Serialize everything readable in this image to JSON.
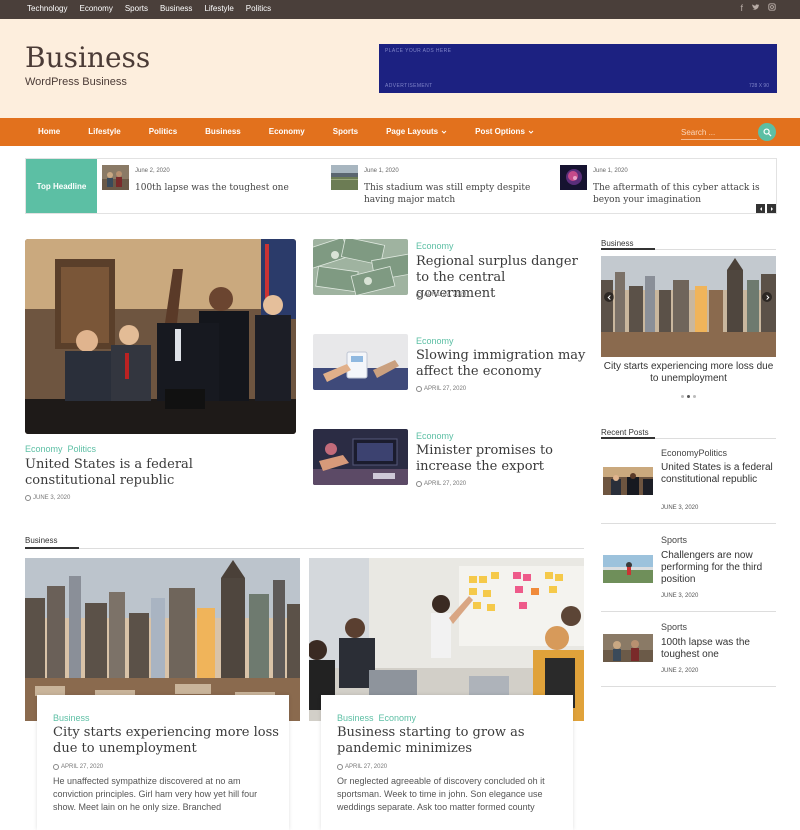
{
  "topbar": {
    "links": [
      "Technology",
      "Economy",
      "Sports",
      "Business",
      "Lifestyle",
      "Politics"
    ],
    "social_icons": [
      "facebook-icon",
      "twitter-icon",
      "instagram-icon"
    ]
  },
  "header": {
    "site_title": "Business",
    "tagline": "WordPress Business",
    "ad_top": "PLACE YOUR ADS HERE",
    "ad_bottom": "ADVERTISEMENT",
    "ad_size": "728 X 90"
  },
  "nav": {
    "items": [
      "Home",
      "Lifestyle",
      "Politics",
      "Business",
      "Economy",
      "Sports",
      "Page Layouts",
      "Post Options"
    ],
    "search_placeholder": "Search ..."
  },
  "ticker": {
    "label": "Top Headline",
    "items": [
      {
        "date": "June 2, 2020",
        "title": "100th lapse was the toughest one"
      },
      {
        "date": "June 1, 2020",
        "title": "This stadium was still empty despite having major match"
      },
      {
        "date": "June 1, 2020",
        "title": "The aftermath of this cyber attack is beyon your imagination"
      }
    ]
  },
  "featured": {
    "cats": [
      "Economy",
      "Politics"
    ],
    "title": "United States is a federal constitutional republic",
    "date": "JUNE 3, 2020"
  },
  "mid_posts": [
    {
      "cat": "Economy",
      "title": "Regional surplus danger to the central government",
      "date": "APRIL 27, 2020"
    },
    {
      "cat": "Economy",
      "title": "Slowing immigration may affect the economy",
      "date": "APRIL 27, 2020"
    },
    {
      "cat": "Economy",
      "title": "Minister promises to increase the export",
      "date": "APRIL 27, 2020"
    }
  ],
  "business_section": {
    "heading": "Business",
    "cards": [
      {
        "cats": [
          "Business"
        ],
        "title": "City starts experiencing more loss due to unemployment",
        "date": "APRIL 27, 2020",
        "excerpt": "He unaffected sympathize discovered at no am conviction principles. Girl ham very how yet hill four show. Meet lain on he only size. Branched"
      },
      {
        "cats": [
          "Business",
          "Economy"
        ],
        "title": "Business starting to grow as pandemic minimizes",
        "date": "APRIL 27, 2020",
        "excerpt": "Or neglected agreeable of discovery concluded oh it sportsman. Week to time in john. Son elegance use weddings separate. Ask too matter formed county"
      }
    ]
  },
  "sidebar": {
    "business_heading": "Business",
    "slide_caption": "City starts experiencing more loss due to unemployment",
    "recent_heading": "Recent Posts",
    "recent": [
      {
        "cat": "EconomyPolitics",
        "title": "United States is a federal constitutional republic",
        "date": "JUNE 3, 2020"
      },
      {
        "cat": "Sports",
        "title": "Challengers are now performing for the third position",
        "date": "JUNE 3, 2020"
      },
      {
        "cat": "Sports",
        "title": "100th lapse was the toughest one",
        "date": "JUNE 2, 2020"
      }
    ]
  },
  "colors": {
    "accent_orange": "#e2711d",
    "accent_teal": "#5cbfa4",
    "header_bg": "#fdeedd",
    "topbar_bg": "#4a3f3a",
    "ad_bg": "#1c2181"
  }
}
